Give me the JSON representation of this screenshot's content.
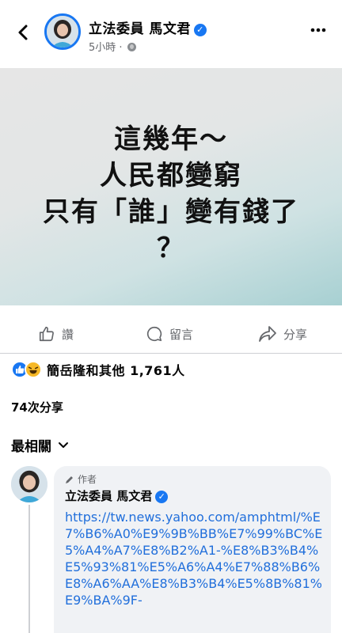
{
  "post": {
    "page_name": "立法委員 馬文君",
    "verified_mark": "✓",
    "time": "5小時",
    "separator": "·",
    "image_text": {
      "line1": "這幾年～",
      "line2": "人民都變窮",
      "line3": "只有「誰」變有錢了",
      "line4": "？"
    }
  },
  "actions": {
    "like": "讚",
    "comment": "留言",
    "share": "分享"
  },
  "reactions": {
    "summary": "簡岳隆和其他 1,761人",
    "types": [
      "like-icon",
      "haha-icon"
    ]
  },
  "shares": {
    "count_text": "74次分享"
  },
  "comments": {
    "sort_label": "最相關",
    "items": [
      {
        "author_tag": "作者",
        "name": "立法委員 馬文君",
        "link": "https://tw.news.yahoo.com/amphtml/%E7%B6%A0%E9%9B%BB%E7%99%BC%E5%A4%A7%E8%B2%A1-%E8%B3%B4%E5%93%81%E5%A6%A4%E7%88%B6%E8%A6%AA%E8%B3%B4%E5%8B%81%E9%BA%9F-"
      }
    ]
  },
  "colors": {
    "accent": "#1877f2",
    "link": "#216fdb",
    "muted": "#65676b"
  }
}
